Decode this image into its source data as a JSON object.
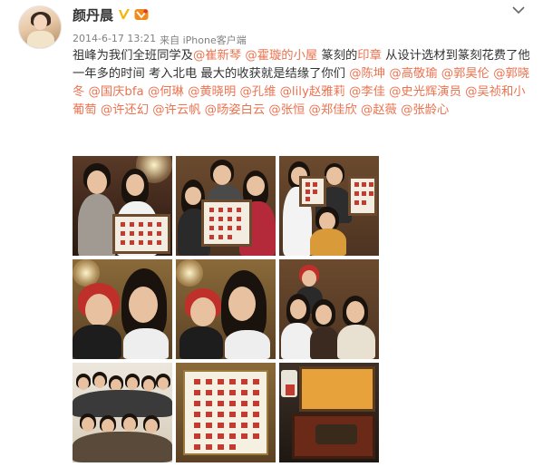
{
  "user": {
    "name": "颜丹晨",
    "avatar_icon": "avatar-photo",
    "verified_icon": "verified-v-icon",
    "vip_icon": "vip-member-icon"
  },
  "post": {
    "timestamp": "2014-6-17 13:21",
    "source": "来自 iPhone客户端",
    "text_segments": [
      {
        "t": "祖峰为我们全班同学及",
        "type": "text"
      },
      {
        "t": "@崔新琴",
        "type": "mention"
      },
      {
        "t": " ",
        "type": "text"
      },
      {
        "t": "@霍璇的小屋",
        "type": "mention"
      },
      {
        "t": " 篆刻的",
        "type": "text"
      },
      {
        "t": "印章",
        "type": "topic"
      },
      {
        "t": " 从设计选材到篆刻花费了他一年多的时间 考入北电 最大的收获就是结缘了你们 ",
        "type": "text"
      },
      {
        "t": "@陈坤",
        "type": "mention"
      },
      {
        "t": " ",
        "type": "text"
      },
      {
        "t": "@高敬瑜",
        "type": "mention"
      },
      {
        "t": " ",
        "type": "text"
      },
      {
        "t": "@郭昊伦",
        "type": "mention"
      },
      {
        "t": " ",
        "type": "text"
      },
      {
        "t": "@郭晓冬",
        "type": "mention"
      },
      {
        "t": " ",
        "type": "text"
      },
      {
        "t": "@国庆bfa",
        "type": "mention"
      },
      {
        "t": " ",
        "type": "text"
      },
      {
        "t": "@何琳",
        "type": "mention"
      },
      {
        "t": " ",
        "type": "text"
      },
      {
        "t": "@黄晓明",
        "type": "mention"
      },
      {
        "t": " ",
        "type": "text"
      },
      {
        "t": "@孔维",
        "type": "mention"
      },
      {
        "t": " ",
        "type": "text"
      },
      {
        "t": "@lily赵雅莉",
        "type": "mention"
      },
      {
        "t": " ",
        "type": "text"
      },
      {
        "t": "@李佳",
        "type": "mention"
      },
      {
        "t": " ",
        "type": "text"
      },
      {
        "t": "@史光辉演员",
        "type": "mention"
      },
      {
        "t": " ",
        "type": "text"
      },
      {
        "t": "@吴祯和小葡萄",
        "type": "mention"
      },
      {
        "t": " ",
        "type": "text"
      },
      {
        "t": "@许还幻",
        "type": "mention"
      },
      {
        "t": " ",
        "type": "text"
      },
      {
        "t": "@许云帆",
        "type": "mention"
      },
      {
        "t": " ",
        "type": "text"
      },
      {
        "t": "@旸姿白云",
        "type": "mention"
      },
      {
        "t": " ",
        "type": "text"
      },
      {
        "t": "@张恒",
        "type": "mention"
      },
      {
        "t": " ",
        "type": "text"
      },
      {
        "t": "@郑佳欣",
        "type": "mention"
      },
      {
        "t": " ",
        "type": "text"
      },
      {
        "t": "@赵薇",
        "type": "mention"
      },
      {
        "t": " ",
        "type": "text"
      },
      {
        "t": "@张龄心",
        "type": "mention"
      }
    ]
  },
  "photos": [
    {
      "id": 1,
      "desc_icon": "photo-couple-with-frame"
    },
    {
      "id": 2,
      "desc_icon": "photo-group-with-frame"
    },
    {
      "id": 3,
      "desc_icon": "photo-group-with-frame-2"
    },
    {
      "id": 4,
      "desc_icon": "photo-selfie-red-hair"
    },
    {
      "id": 5,
      "desc_icon": "photo-selfie-kiss"
    },
    {
      "id": 6,
      "desc_icon": "photo-women-group"
    },
    {
      "id": 7,
      "desc_icon": "photo-class-group"
    },
    {
      "id": 8,
      "desc_icon": "photo-seal-frame"
    },
    {
      "id": 9,
      "desc_icon": "photo-seal-box"
    }
  ],
  "colors": {
    "link": "#eb7350",
    "text": "#333333",
    "meta": "#808080",
    "verified": "#f7b500"
  }
}
